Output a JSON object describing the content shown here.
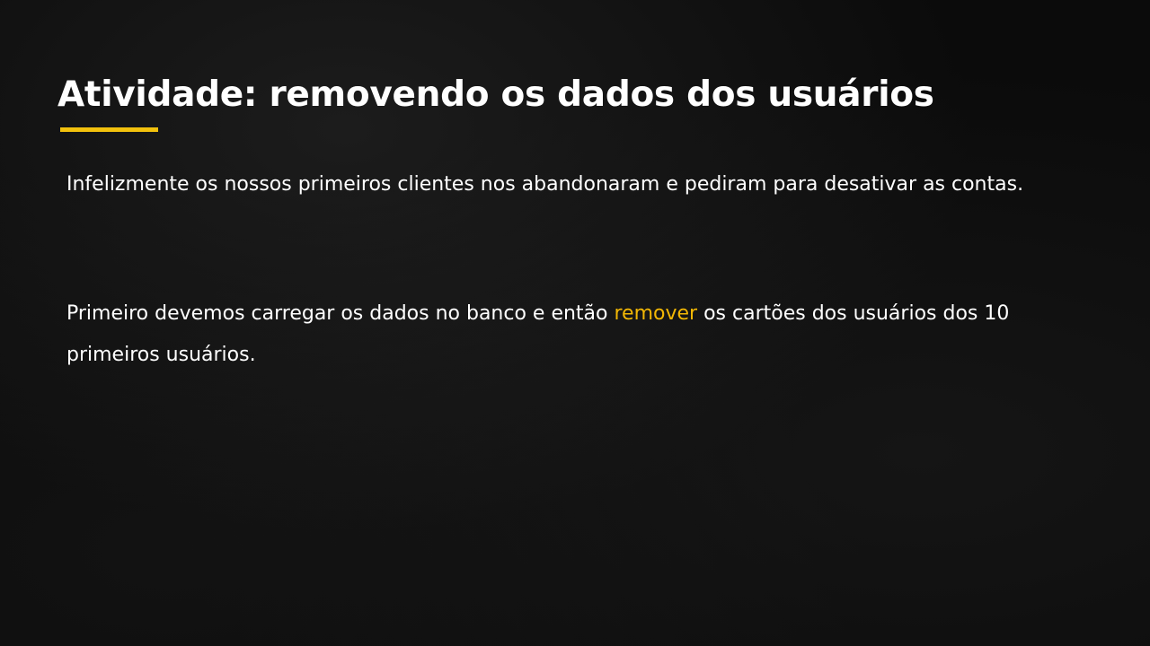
{
  "slide": {
    "title": "Atividade: removendo os dados dos usuários",
    "paragraph1": "Infelizmente os nossos primeiros clientes nos abandonaram e pediram para desativar as contas.",
    "paragraph2": {
      "before": "Primeiro devemos carregar os dados no banco e então ",
      "highlight": "remover",
      "after": " os cartões dos usuários dos 10 primeiros usuários."
    },
    "colors": {
      "background": "#0b0b0b",
      "text": "#ffffff",
      "accent": "#f2c10d",
      "highlight": "#f2b705"
    }
  }
}
